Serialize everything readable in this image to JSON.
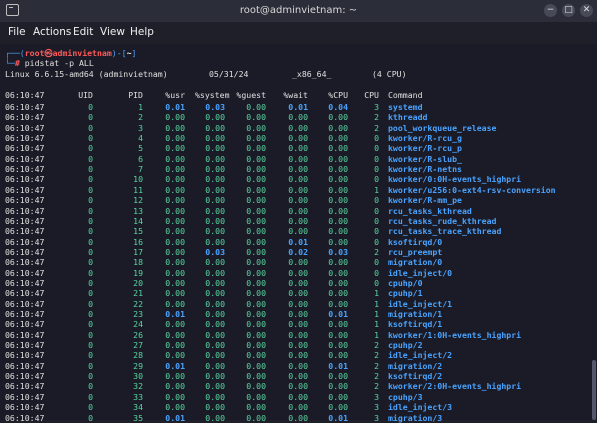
{
  "window": {
    "title": "root@adminvietnam: ~",
    "buttons": [
      "−",
      "□",
      "✕"
    ]
  },
  "menu": {
    "items": [
      "File",
      "Actions",
      "Edit",
      "View",
      "Help"
    ]
  },
  "prompt": {
    "open": "┌──(",
    "user": "root㉿adminvietnam",
    "mid": ")-[",
    "path": "~",
    "close": "]",
    "hash_prefix": "└─",
    "hash": "#",
    "command": "pidstat -p ALL"
  },
  "sysinfo": {
    "kernel": "Linux 6.6.15-amd64 (adminvietnam)",
    "date": "05/31/24",
    "arch": "_x86_64_",
    "cpus": "(4 CPU)"
  },
  "table": {
    "headers": [
      "06:10:47",
      "UID",
      "PID",
      "%usr",
      "%system",
      "%guest",
      "%wait",
      "%CPU",
      "CPU",
      "Command"
    ],
    "rows": [
      [
        "06:10:47",
        "0",
        "1",
        "0.01",
        "0.03",
        "0.00",
        "0.01",
        "0.04",
        "3",
        "systemd"
      ],
      [
        "06:10:47",
        "0",
        "2",
        "0.00",
        "0.00",
        "0.00",
        "0.00",
        "0.00",
        "2",
        "kthreadd"
      ],
      [
        "06:10:47",
        "0",
        "3",
        "0.00",
        "0.00",
        "0.00",
        "0.00",
        "0.00",
        "2",
        "pool_workqueue_release"
      ],
      [
        "06:10:47",
        "0",
        "4",
        "0.00",
        "0.00",
        "0.00",
        "0.00",
        "0.00",
        "0",
        "kworker/R-rcu_g"
      ],
      [
        "06:10:47",
        "0",
        "5",
        "0.00",
        "0.00",
        "0.00",
        "0.00",
        "0.00",
        "0",
        "kworker/R-rcu_p"
      ],
      [
        "06:10:47",
        "0",
        "6",
        "0.00",
        "0.00",
        "0.00",
        "0.00",
        "0.00",
        "0",
        "kworker/R-slub_"
      ],
      [
        "06:10:47",
        "0",
        "7",
        "0.00",
        "0.00",
        "0.00",
        "0.00",
        "0.00",
        "0",
        "kworker/R-netns"
      ],
      [
        "06:10:47",
        "0",
        "10",
        "0.00",
        "0.00",
        "0.00",
        "0.00",
        "0.00",
        "0",
        "kworker/0:0H-events_highpri"
      ],
      [
        "06:10:47",
        "0",
        "11",
        "0.00",
        "0.00",
        "0.00",
        "0.00",
        "0.00",
        "1",
        "kworker/u256:0-ext4-rsv-conversion"
      ],
      [
        "06:10:47",
        "0",
        "12",
        "0.00",
        "0.00",
        "0.00",
        "0.00",
        "0.00",
        "0",
        "kworker/R-mm_pe"
      ],
      [
        "06:10:47",
        "0",
        "13",
        "0.00",
        "0.00",
        "0.00",
        "0.00",
        "0.00",
        "0",
        "rcu_tasks_kthread"
      ],
      [
        "06:10:47",
        "0",
        "14",
        "0.00",
        "0.00",
        "0.00",
        "0.00",
        "0.00",
        "0",
        "rcu_tasks_rude_kthread"
      ],
      [
        "06:10:47",
        "0",
        "15",
        "0.00",
        "0.00",
        "0.00",
        "0.00",
        "0.00",
        "0",
        "rcu_tasks_trace_kthread"
      ],
      [
        "06:10:47",
        "0",
        "16",
        "0.00",
        "0.00",
        "0.00",
        "0.01",
        "0.00",
        "0",
        "ksoftirqd/0"
      ],
      [
        "06:10:47",
        "0",
        "17",
        "0.00",
        "0.03",
        "0.00",
        "0.02",
        "0.03",
        "2",
        "rcu_preempt"
      ],
      [
        "06:10:47",
        "0",
        "18",
        "0.00",
        "0.00",
        "0.00",
        "0.00",
        "0.00",
        "0",
        "migration/0"
      ],
      [
        "06:10:47",
        "0",
        "19",
        "0.00",
        "0.00",
        "0.00",
        "0.00",
        "0.00",
        "0",
        "idle_inject/0"
      ],
      [
        "06:10:47",
        "0",
        "20",
        "0.00",
        "0.00",
        "0.00",
        "0.00",
        "0.00",
        "0",
        "cpuhp/0"
      ],
      [
        "06:10:47",
        "0",
        "21",
        "0.00",
        "0.00",
        "0.00",
        "0.00",
        "0.00",
        "1",
        "cpuhp/1"
      ],
      [
        "06:10:47",
        "0",
        "22",
        "0.00",
        "0.00",
        "0.00",
        "0.00",
        "0.00",
        "1",
        "idle_inject/1"
      ],
      [
        "06:10:47",
        "0",
        "23",
        "0.01",
        "0.00",
        "0.00",
        "0.00",
        "0.01",
        "1",
        "migration/1"
      ],
      [
        "06:10:47",
        "0",
        "24",
        "0.00",
        "0.00",
        "0.00",
        "0.00",
        "0.00",
        "1",
        "ksoftirqd/1"
      ],
      [
        "06:10:47",
        "0",
        "26",
        "0.00",
        "0.00",
        "0.00",
        "0.00",
        "0.00",
        "1",
        "kworker/1:0H-events_highpri"
      ],
      [
        "06:10:47",
        "0",
        "27",
        "0.00",
        "0.00",
        "0.00",
        "0.00",
        "0.00",
        "2",
        "cpuhp/2"
      ],
      [
        "06:10:47",
        "0",
        "28",
        "0.00",
        "0.00",
        "0.00",
        "0.00",
        "0.00",
        "2",
        "idle_inject/2"
      ],
      [
        "06:10:47",
        "0",
        "29",
        "0.01",
        "0.00",
        "0.00",
        "0.00",
        "0.01",
        "2",
        "migration/2"
      ],
      [
        "06:10:47",
        "0",
        "30",
        "0.00",
        "0.00",
        "0.00",
        "0.00",
        "0.00",
        "2",
        "ksoftirqd/2"
      ],
      [
        "06:10:47",
        "0",
        "32",
        "0.00",
        "0.00",
        "0.00",
        "0.00",
        "0.00",
        "2",
        "kworker/2:0H-events_highpri"
      ],
      [
        "06:10:47",
        "0",
        "33",
        "0.00",
        "0.00",
        "0.00",
        "0.00",
        "0.00",
        "3",
        "cpuhp/3"
      ],
      [
        "06:10:47",
        "0",
        "34",
        "0.00",
        "0.00",
        "0.00",
        "0.00",
        "0.00",
        "3",
        "idle_inject/3"
      ],
      [
        "06:10:47",
        "0",
        "35",
        "0.01",
        "0.00",
        "0.00",
        "0.00",
        "0.01",
        "3",
        "migration/3"
      ]
    ]
  },
  "colors": {
    "accent_blue": "#4aa3ff",
    "prompt_red": "#ff5a5a",
    "prompt_blue": "#4aa3ff",
    "terminal_bg": "#1a1b26"
  }
}
